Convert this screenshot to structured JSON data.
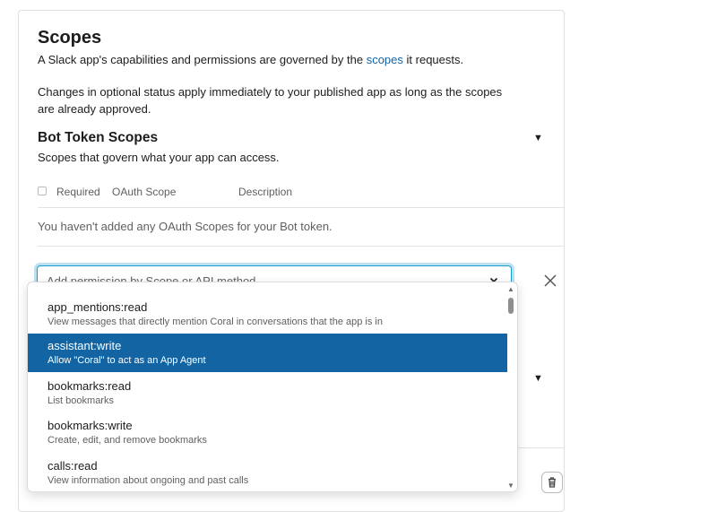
{
  "scopes": {
    "title": "Scopes",
    "intro_before_link": "A Slack app's capabilities and permissions are governed by the ",
    "intro_link": "scopes",
    "intro_after_link": " it requests.",
    "note": "Changes in optional status apply immediately to your published app as long as the scopes are already approved."
  },
  "bot_section": {
    "title": "Bot Token Scopes",
    "subtitle": "Scopes that govern what your app can access.",
    "columns": [
      "Required",
      "OAuth Scope",
      "Description"
    ],
    "empty_message": "You haven't added any OAuth Scopes for your Bot token.",
    "add_placeholder": "Add permission by Scope or API method..."
  },
  "options": [
    {
      "scope": "app_mentions:read",
      "desc": "View messages that directly mention Coral in conversations that the app is in",
      "selected": false
    },
    {
      "scope": "assistant:write",
      "desc": "Allow \"Coral\" to act as an App Agent",
      "selected": true
    },
    {
      "scope": "bookmarks:read",
      "desc": "List bookmarks",
      "selected": false
    },
    {
      "scope": "bookmarks:write",
      "desc": "Create, edit, and remove bookmarks",
      "selected": false
    },
    {
      "scope": "calls:read",
      "desc": "View information about ongoing and past calls",
      "selected": false
    }
  ],
  "colors": {
    "accent": "#1264a3",
    "focus": "#1d9bd1"
  },
  "icons": [
    "caret-down-icon",
    "chevron-down-icon",
    "close-icon",
    "trash-icon"
  ]
}
